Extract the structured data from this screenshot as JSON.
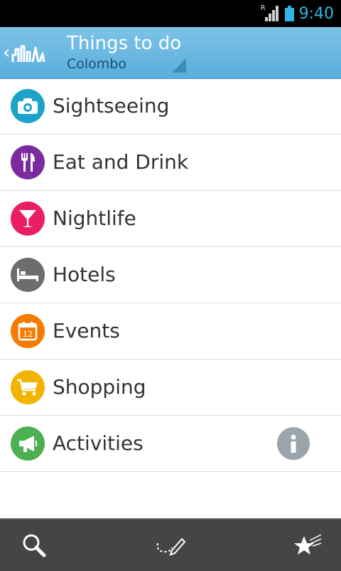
{
  "status": {
    "time": "9:40",
    "roaming_indicator": "R",
    "battery_color": "#32b5e5"
  },
  "header": {
    "title": "Things to do",
    "subtitle": "Colombo"
  },
  "list": {
    "items": [
      {
        "label": "Sightseeing",
        "icon": "camera-icon",
        "color": "#1ba3c9"
      },
      {
        "label": "Eat and Drink",
        "icon": "fork-knife-icon",
        "color": "#7b2aa0"
      },
      {
        "label": "Nightlife",
        "icon": "cocktail-icon",
        "color": "#e91e63"
      },
      {
        "label": "Hotels",
        "icon": "bed-icon",
        "color": "#6d6d6d"
      },
      {
        "label": "Events",
        "icon": "calendar-icon",
        "color": "#f57c00"
      },
      {
        "label": "Shopping",
        "icon": "cart-icon",
        "color": "#f3b400"
      },
      {
        "label": "Activities",
        "icon": "megaphone-icon",
        "color": "#4caf50"
      }
    ],
    "events_calendar_day": "12"
  },
  "bottombar": {
    "icons": [
      "search-icon",
      "route-pen-icon",
      "favorites-star-icon"
    ]
  }
}
